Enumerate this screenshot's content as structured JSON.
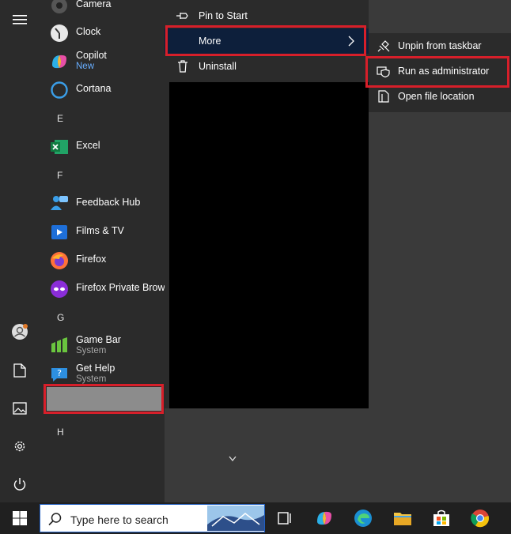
{
  "apps": [
    {
      "name": "Camera",
      "icon": "camera-icon"
    },
    {
      "name": "Clock",
      "icon": "clock-icon"
    },
    {
      "name": "Copilot",
      "sub": "New",
      "icon": "copilot-icon"
    },
    {
      "name": "Cortana",
      "icon": "cortana-icon"
    },
    {
      "name": "Excel",
      "icon": "excel-icon"
    },
    {
      "name": "Feedback Hub",
      "icon": "feedback-hub-icon"
    },
    {
      "name": "Films & TV",
      "icon": "films-tv-icon"
    },
    {
      "name": "Firefox",
      "icon": "firefox-icon"
    },
    {
      "name": "Firefox Private Browsi",
      "icon": "firefox-private-icon"
    },
    {
      "name": "Game Bar",
      "sub": "System",
      "icon": "game-bar-icon"
    },
    {
      "name": "Get Help",
      "sub": "System",
      "icon": "get-help-icon"
    }
  ],
  "letters": {
    "e": "E",
    "f": "F",
    "g": "G",
    "h": "H"
  },
  "context_menu": {
    "pin_to_start": "Pin to Start",
    "more": "More",
    "uninstall": "Uninstall"
  },
  "more_submenu": {
    "unpin_from_taskbar": "Unpin from taskbar",
    "run_as_administrator": "Run as administrator",
    "open_file_location": "Open file location"
  },
  "taskbar": {
    "search_placeholder": "Type here to search",
    "icons": [
      "start-icon",
      "task-view-icon",
      "copilot-icon",
      "edge-icon",
      "file-explorer-icon",
      "store-icon",
      "chrome-icon"
    ]
  },
  "colors": {
    "highlight_border": "#d71f2a",
    "menu_background": "#2b2b2b",
    "more_item_background": "#0d1f3b",
    "taskbar": "#202020"
  }
}
